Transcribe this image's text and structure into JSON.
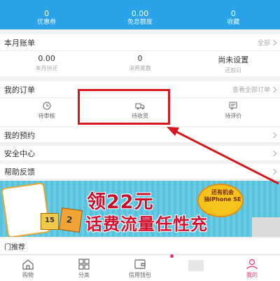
{
  "topbar": {
    "stats": [
      {
        "value": "0",
        "label": "优惠券"
      },
      {
        "value": "0.00",
        "label": "免息额度"
      },
      {
        "value": "0",
        "label": "收藏"
      }
    ]
  },
  "bill": {
    "title": "本月账单",
    "more": "全部",
    "items": [
      {
        "value": "0.00",
        "label": "本月待还"
      },
      {
        "value": "0",
        "label": "消费笔数"
      },
      {
        "value": "尚未设置",
        "label": "还款日"
      }
    ]
  },
  "orders": {
    "title": "我的订单",
    "more": "查看全部订单",
    "items": [
      {
        "label": "待审核",
        "icon": "clock-icon"
      },
      {
        "label": "待收货",
        "icon": "truck-icon"
      },
      {
        "label": "待评价",
        "icon": "comment-icon"
      }
    ]
  },
  "menu": [
    {
      "label": "我的预约"
    },
    {
      "label": "安全中心"
    },
    {
      "label": "帮助反馈"
    }
  ],
  "banner": {
    "headline": "领22元",
    "slogan": "话费流量任性充",
    "promo_line1": "还有机会",
    "promo_line2": "抽iPhone SE",
    "box_number_1": "15",
    "box_number_2": "2"
  },
  "recommend": {
    "title": "门推荐"
  },
  "tabbar": {
    "tabs": [
      {
        "label": "购物",
        "icon": "home-icon"
      },
      {
        "label": "分类",
        "icon": "grid-icon"
      },
      {
        "label": "信用钱包",
        "icon": "wallet-icon"
      },
      {
        "label": "",
        "icon": "placeholder"
      },
      {
        "label": "我的",
        "icon": "user-icon"
      }
    ]
  },
  "colors": {
    "primary": "#29a2e8",
    "accent": "#e8336b",
    "highlight": "#d9151c"
  }
}
